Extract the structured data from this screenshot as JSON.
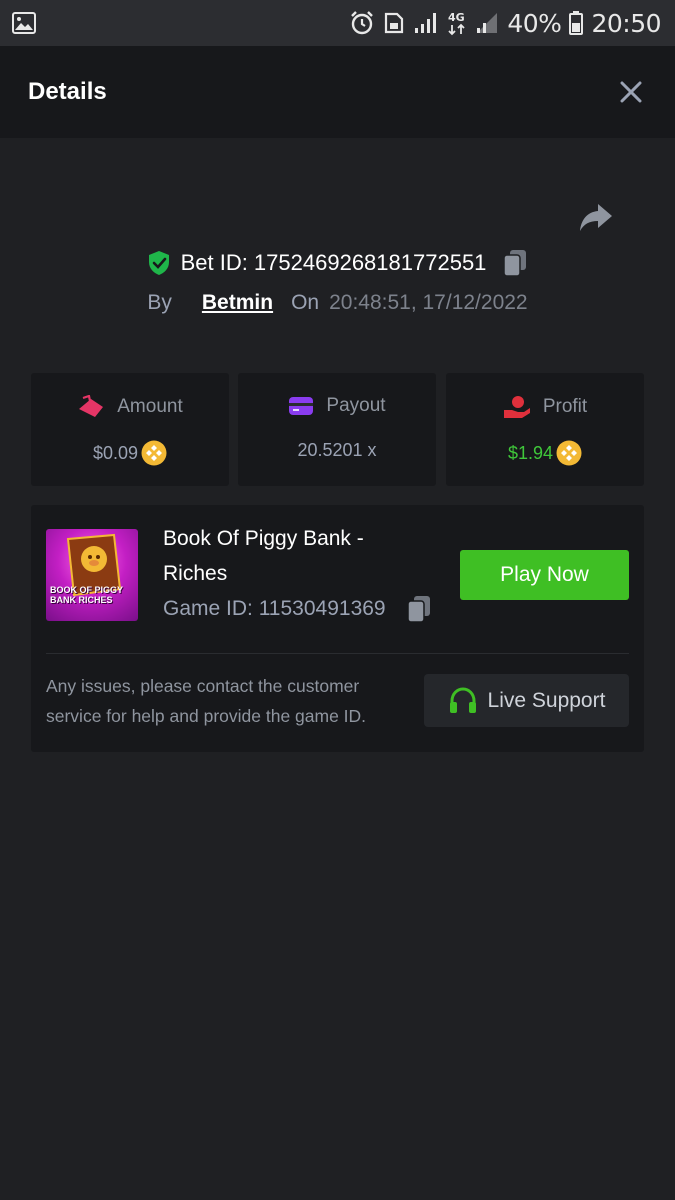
{
  "status_bar": {
    "battery_percent": "40%",
    "time": "20:50",
    "network_label": "4G"
  },
  "header": {
    "title": "Details"
  },
  "bet": {
    "id_text": "Bet ID: 1752469268181772551",
    "by_label": "By",
    "user": "Betmin",
    "on_label": "On",
    "datetime": "20:48:51, 17/12/2022"
  },
  "stats": {
    "amount": {
      "label": "Amount",
      "value": "$0.09"
    },
    "payout": {
      "label": "Payout",
      "value": "20.5201 x"
    },
    "profit": {
      "label": "Profit",
      "value": "$1.94"
    }
  },
  "game": {
    "title": "Book Of Piggy Bank - Riches",
    "id_text": "Game ID: 11530491369",
    "thumbnail_text": "BOOK OF PIGGY BANK RICHES",
    "play_label": "Play Now",
    "support_text": "Any issues, please contact the customer service for help and provide the game ID.",
    "support_label": "Live Support"
  },
  "colors": {
    "background": "#1f2023",
    "card": "#17181b",
    "accent_green": "#3fbf24",
    "profit_green": "#3fc73a",
    "shield_green": "#1fb64a"
  }
}
